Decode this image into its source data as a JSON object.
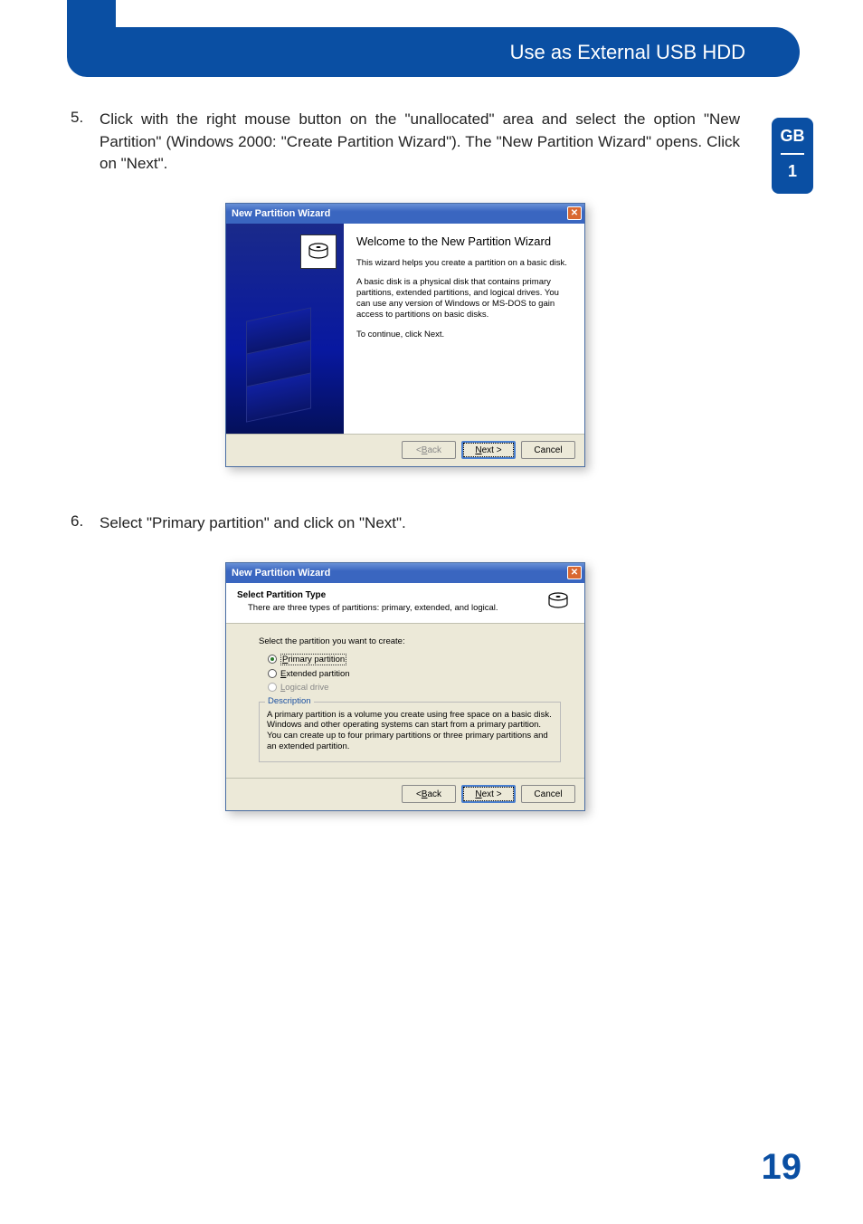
{
  "header": {
    "title": "Use as External USB HDD"
  },
  "sideTab": {
    "lang": "GB",
    "section": "1"
  },
  "steps": {
    "s5": {
      "num": "5.",
      "text": "Click with the right mouse button on the \"unallocated\" area and select the option \"New Partition\" (Windows 2000: \"Create Partition Wizard\"). The \"New Partition Wizard\" opens. Click on \"Next\"."
    },
    "s6": {
      "num": "6.",
      "text": "Select \"Primary partition\" and click on \"Next\"."
    }
  },
  "dialog1": {
    "title": "New Partition Wizard",
    "heading": "Welcome to the New Partition Wizard",
    "p1": "This wizard helps you create a partition on a basic disk.",
    "p2": "A basic disk is a physical disk that contains primary partitions, extended partitions, and logical drives. You can use any version of Windows or MS-DOS to gain access to partitions on basic disks.",
    "p3": "To continue, click Next.",
    "buttons": {
      "back": "< Back",
      "next": "Next >",
      "cancel": "Cancel"
    }
  },
  "dialog2": {
    "title": "New Partition Wizard",
    "header_title": "Select Partition Type",
    "header_sub": "There are three types of partitions: primary, extended, and logical.",
    "prompt": "Select the partition you want to create:",
    "options": {
      "primary": "Primary partition",
      "extended": "Extended partition",
      "logical": "Logical drive"
    },
    "desc_legend": "Description",
    "desc_text": "A primary partition is a volume you create using free space on a basic disk. Windows and other operating systems can start from a primary partition. You can create up to four primary partitions or three primary partitions and an extended partition.",
    "buttons": {
      "back": "< Back",
      "next": "Next >",
      "cancel": "Cancel"
    }
  },
  "pageNumber": "19"
}
